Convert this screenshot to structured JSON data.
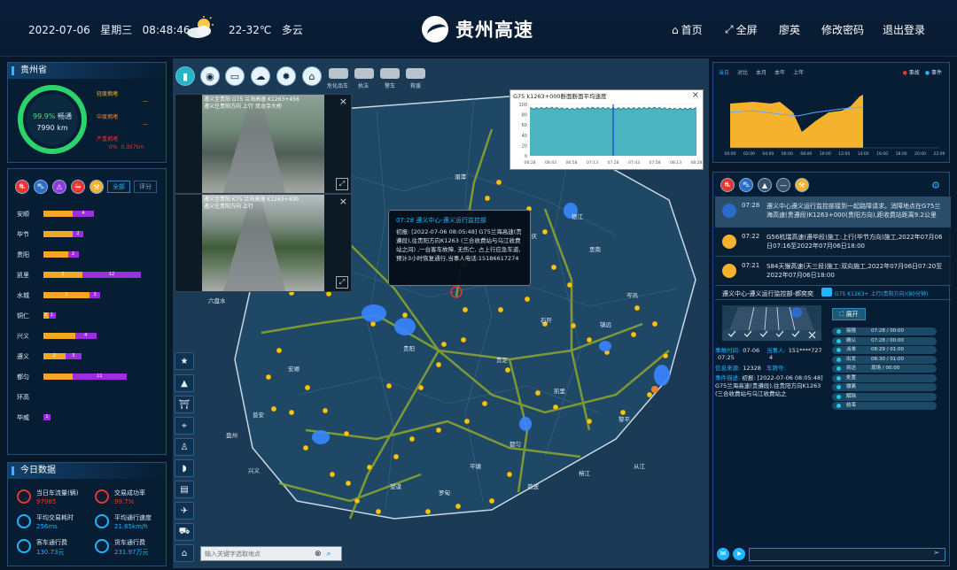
{
  "header": {
    "date": "2022-07-06",
    "weekday": "星期三",
    "time": "08:48:46",
    "weather_icon": "sun-cloud-icon",
    "temperature": "22-32℃",
    "weather": "多云",
    "brand": "贵州高速",
    "nav": [
      "首页",
      "全屏",
      "廖英",
      "修改密码",
      "退出登录"
    ]
  },
  "province": {
    "title": "贵州省",
    "percent": "99.9%",
    "status": "畅通",
    "length": "7990 km",
    "legend": [
      {
        "label": "轻度拥堵",
        "value": "—",
        "color": "#f5b22c"
      },
      {
        "label": "中度拥堵",
        "value": "—",
        "color": "#f0822c"
      },
      {
        "label": "严重拥堵",
        "value": "0%",
        "value2": "0.307km",
        "color": "#e5372d"
      }
    ]
  },
  "routes": {
    "tabs": [
      "全部",
      "评分"
    ],
    "rows": [
      {
        "name": "安顺",
        "a": "",
        "b": "4",
        "av": 60,
        "bv": 4
      },
      {
        "name": "毕节",
        "a": "",
        "b": "2",
        "av": 60,
        "bv": 2
      },
      {
        "name": "贵阳",
        "a": "",
        "b": "2",
        "av": 50,
        "bv": 2
      },
      {
        "name": "凯里",
        "a": "1",
        "b": "12",
        "av": 80,
        "bv": 12
      },
      {
        "name": "水城",
        "a": "2",
        "b": "2",
        "av": 95,
        "bv": 2
      },
      {
        "name": "铜仁",
        "a": "1",
        "b": "1",
        "av": 10,
        "bv": 1
      },
      {
        "name": "兴义",
        "a": "",
        "b": "4",
        "av": 65,
        "bv": 4
      },
      {
        "name": "遵义",
        "a": "2",
        "b": "3",
        "av": 45,
        "bv": 3
      },
      {
        "name": "都匀",
        "a": "",
        "b": "11",
        "av": 60,
        "bv": 11
      },
      {
        "name": "环高",
        "a": "",
        "b": "",
        "av": 0,
        "bv": 0
      },
      {
        "name": "毕威",
        "a": "",
        "b": "1",
        "av": 0,
        "bv": 1
      }
    ]
  },
  "today": {
    "title": "今日数据",
    "items": [
      {
        "label": "当日车流量(辆)",
        "value": "97985",
        "color": "#e5372d"
      },
      {
        "label": "交易成功率",
        "value": "99.7%",
        "color": "#e5372d"
      },
      {
        "label": "平均交易耗时",
        "value": "256ms",
        "color": "#1fb6ff"
      },
      {
        "label": "平均通行速度",
        "value": "21.65km/h",
        "color": "#1fb6ff"
      },
      {
        "label": "客车通行费",
        "value": "130.73元",
        "color": "#1fb6ff"
      },
      {
        "label": "货车通行费",
        "value": "231.97万元",
        "color": "#1fb6ff"
      }
    ]
  },
  "map_toolbar": {
    "labels": [
      "危化品车",
      "执法",
      "警车",
      "救援"
    ]
  },
  "cameras": [
    {
      "caption1": "遵义至贵阳 G75 兰海高速 K1263+456",
      "caption2": "遵义往贵阳方向 上行 双龙寺大桥"
    },
    {
      "caption1": "遵义至贵阳 K75 兰海高速 K1263+400",
      "caption2": "遵义往贵阳方向 上行"
    }
  ],
  "popup": {
    "title": "07:28 遵义中心-遵义运行监控部",
    "body": "初报: [2022-07-06 08:05:48] G75兰海高速(贵遵段),往贵阳方向K1263 (三合收费站与乌江收费站之间) ,一台客车故障, 无伤亡, 占上行应急车道,预计3小时恢复通行,当事人电话:15186617274"
  },
  "speed_chart": {
    "title": "G75 k1263+000断面断面平均速度",
    "yticks": [
      "100",
      "80",
      "60",
      "40",
      "20",
      "0"
    ],
    "xticks": [
      "08:28",
      "08:43",
      "06:58",
      "07:13",
      "07:28",
      "07:43",
      "07:58",
      "08:13",
      "08:28"
    ]
  },
  "chart_data": {
    "type": "line",
    "title": "G75 k1263+000断面断面平均速度",
    "x": [
      "08:28",
      "08:43",
      "06:58",
      "07:13",
      "07:28",
      "07:43",
      "07:58",
      "08:13",
      "08:28"
    ],
    "series": [
      {
        "values": [
          92,
          93,
          91,
          93,
          92,
          92,
          93,
          91,
          92
        ]
      }
    ],
    "ylim": [
      0,
      100
    ]
  },
  "map_labels": [
    "毕节",
    "遵义",
    "贵阳",
    "安顺",
    "六盘水",
    "兴义",
    "铜仁",
    "凯里",
    "都匀",
    "贵定",
    "湄潭",
    "余庆",
    "德江",
    "思南",
    "石阡",
    "镇远",
    "岑巩",
    "黎平",
    "榕江",
    "从江",
    "荔波",
    "平塘",
    "罗甸",
    "望谟",
    "普安",
    "盘州"
  ],
  "search": {
    "placeholder": "输入关键字选取地点"
  },
  "flow_chart": {
    "tabs": [
      "当日",
      "对比",
      "本月",
      "本年",
      "上年"
    ],
    "legend": [
      "事故",
      "事件"
    ],
    "xticks": [
      "00:00",
      "02:00",
      "04:00",
      "06:00",
      "08:00",
      "10:00",
      "12:00",
      "14:00",
      "16:00",
      "18:00",
      "20:00",
      "22:00"
    ]
  },
  "events": [
    {
      "time": "07:28",
      "text": "遵义中心遵义运行监控部接到一起路障请求。消障地点在G75兰海高速(贵遵段)K1263+000(贵阳方向),距收费站距离9.2公里",
      "icon": "car-icon"
    },
    {
      "time": "07:22",
      "text": "G56杭瑞高速(遵毕段)施工:上行(毕节方向)施工,2022年07月06日07:16至2022年07月06日18:00",
      "icon": "construction-icon"
    },
    {
      "time": "07:21",
      "text": "S84天猴高速(天三段)施工:双向施工,2022年07月06日07:20至2022年07月06日18:00",
      "icon": "construction-icon"
    }
  ],
  "detail": {
    "title": "遵义中心-遵义运行监控部-郝奕奕",
    "badge": "G75 K1263+ 上行(贵阳方向)(80分钟)",
    "expand": "展开",
    "fields": [
      {
        "k": "事故时间:",
        "v": "07-06"
      },
      {
        "k": "当事人:",
        "v": "151****727"
      },
      {
        "k": "",
        "v": "07:25"
      },
      {
        "k": "",
        "v": "4"
      },
      {
        "k": "信息来源:",
        "v": "12328"
      },
      {
        "k": "车牌号:",
        "v": ""
      }
    ],
    "desc_label": "事件描述:",
    "desc": "初报: [2022-07-06 08:05:48] G75兰海高速(贵遵段),往贵阳方向K1263 (三合收费站与乌江收费站之",
    "timeline": [
      {
        "label": "接报",
        "time": "07:28 / 00:00"
      },
      {
        "label": "确认",
        "time": "07:28 / 00:00"
      },
      {
        "label": "派单",
        "time": "08:29 / 01:00"
      },
      {
        "label": "出发",
        "time": "08:30 / 01:00"
      },
      {
        "label": "到达",
        "time": "现场 / 00:00"
      },
      {
        "label": "处置",
        "time": ""
      },
      {
        "label": "撤离",
        "time": ""
      },
      {
        "label": "解除",
        "time": ""
      },
      {
        "label": "结束",
        "time": ""
      }
    ]
  }
}
